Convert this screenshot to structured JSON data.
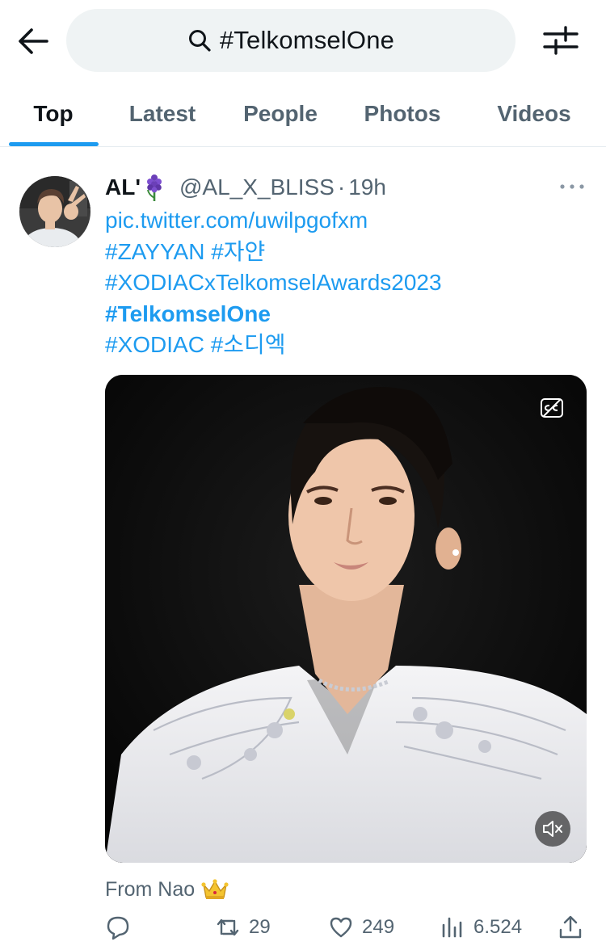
{
  "search": {
    "query": "#TelkomselOne"
  },
  "tabs": [
    {
      "label": "Top",
      "active": true
    },
    {
      "label": "Latest",
      "active": false
    },
    {
      "label": "People",
      "active": false
    },
    {
      "label": "Photos",
      "active": false
    },
    {
      "label": "Videos",
      "active": false
    }
  ],
  "tweet": {
    "display_name": "AL'",
    "name_emoji": "hyacinth-emoji",
    "handle": "@AL_X_BLISS",
    "separator": "·",
    "time": "19h",
    "lines": [
      "pic.twitter.com/uwilpgofxm",
      "#ZAYYAN #자얀",
      "#XODIAC​xTelkomselAwards2023",
      "#TelkomselOne",
      "#XODIAC #소디엑"
    ],
    "attribution": "From Nao",
    "attribution_emoji": "crown-emoji",
    "actions": {
      "replies": "",
      "retweets": "29",
      "likes": "249",
      "views": "6.524"
    }
  },
  "colors": {
    "accent": "#1d9bf0",
    "text": "#0f1419",
    "secondary": "#536471",
    "search_bg": "#eff3f4"
  },
  "icons": [
    "back-arrow-icon",
    "search-icon",
    "filter-icon",
    "more-icon",
    "closed-captions-icon",
    "mute-icon",
    "reply-icon",
    "retweet-icon",
    "like-icon",
    "views-icon",
    "share-icon"
  ]
}
